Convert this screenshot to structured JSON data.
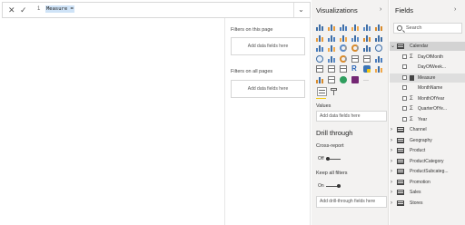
{
  "formula": {
    "line_number": "1",
    "text": "Measure =",
    "cancel_icon": "close-icon",
    "commit_icon": "check-icon",
    "expand_icon": "chevron-down-icon"
  },
  "filters": {
    "this_page_label": "Filters on this page",
    "this_page_drop": "Add data fields here",
    "all_pages_label": "Filters on all pages",
    "all_pages_drop": "Add data fields here"
  },
  "visualizations": {
    "title": "Visualizations",
    "collapse_icon": "chevron-right-icon",
    "values_label": "Values",
    "values_placeholder": "Add data fields here",
    "drill_title": "Drill through",
    "cross_report_label": "Cross-report",
    "cross_report_state": "Off",
    "keep_filters_label": "Keep all filters",
    "keep_filters_state": "On",
    "drill_placeholder": "Add drill-through fields here",
    "accent": "#f2c811"
  },
  "fields": {
    "title": "Fields",
    "collapse_icon": "chevron-right-icon",
    "search_placeholder": "Search",
    "tables": [
      {
        "name": "Calendar",
        "expanded": true
      },
      {
        "name": "Channel"
      },
      {
        "name": "Geography"
      },
      {
        "name": "Product"
      },
      {
        "name": "ProductCategory"
      },
      {
        "name": "ProductSubcateg..."
      },
      {
        "name": "Promotion"
      },
      {
        "name": "Sales"
      },
      {
        "name": "Stores"
      }
    ],
    "calendar_fields": [
      {
        "name": "DayOfMonth",
        "kind": "sigma"
      },
      {
        "name": "DayOfWeek...",
        "kind": "text"
      },
      {
        "name": "Measure",
        "kind": "calc"
      },
      {
        "name": "MonthName",
        "kind": "text"
      },
      {
        "name": "MonthOfYear",
        "kind": "sigma"
      },
      {
        "name": "QuarterOfYe...",
        "kind": "sigma"
      },
      {
        "name": "Year",
        "kind": "sigma"
      }
    ]
  }
}
